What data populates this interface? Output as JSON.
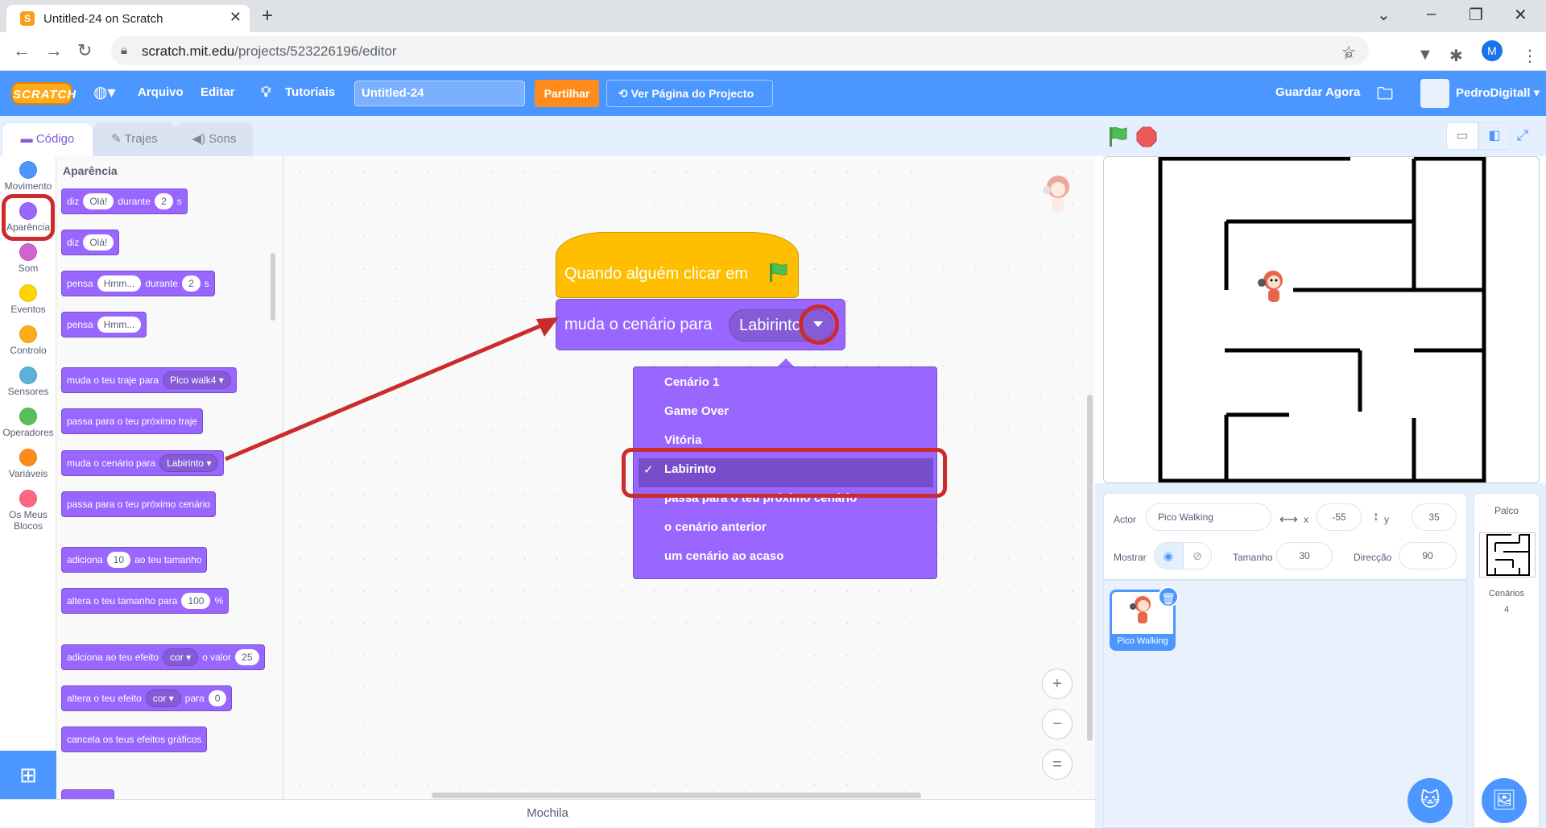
{
  "browser": {
    "tab_title": "Untitled-24 on Scratch",
    "tab_favicon": "S",
    "url_host": "scratch.mit.edu",
    "url_path": "/projects/523226196/editor",
    "profile_initial": "M"
  },
  "menubar": {
    "logo": "SCRATCH",
    "file": "Arquivo",
    "edit": "Editar",
    "tutorials": "Tutoriais",
    "project_title": "Untitled-24",
    "share": "Partilhar",
    "project_page": "Ver Página do Projecto",
    "save_now": "Guardar Agora",
    "username": "PedroDigitall"
  },
  "tabs": {
    "code": "Código",
    "costumes": "Trajes",
    "sounds": "Sons"
  },
  "categories": [
    {
      "label": "Movimento",
      "color": "#4c97ff"
    },
    {
      "label": "Aparência",
      "color": "#9966ff"
    },
    {
      "label": "Som",
      "color": "#cf63cf"
    },
    {
      "label": "Eventos",
      "color": "#ffd500"
    },
    {
      "label": "Controlo",
      "color": "#ffab19"
    },
    {
      "label": "Sensores",
      "color": "#5cb1d6"
    },
    {
      "label": "Operadores",
      "color": "#59c059"
    },
    {
      "label": "Variáveis",
      "color": "#ff8c1a"
    },
    {
      "label": "Os Meus Blocos",
      "color": "#ff6680"
    }
  ],
  "palette": {
    "heading": "Aparência",
    "say_for": {
      "t1": "diz",
      "v1": "Olá!",
      "t2": "durante",
      "v2": "2",
      "t3": "s"
    },
    "say": {
      "t1": "diz",
      "v1": "Olá!"
    },
    "think_for": {
      "t1": "pensa",
      "v1": "Hmm...",
      "t2": "durante",
      "v2": "2",
      "t3": "s"
    },
    "think": {
      "t1": "pensa",
      "v1": "Hmm..."
    },
    "switch_costume": {
      "t1": "muda o teu traje para",
      "v1": "Pico walk4"
    },
    "next_costume": "passa para o teu próximo traje",
    "switch_backdrop": {
      "t1": "muda o cenário para",
      "v1": "Labirinto"
    },
    "next_backdrop": "passa para o teu próximo cenário",
    "change_size": {
      "t1": "adiciona",
      "v1": "10",
      "t2": "ao teu tamanho"
    },
    "set_size": {
      "t1": "altera o teu tamanho para",
      "v1": "100",
      "t2": "%"
    },
    "change_effect": {
      "t1": "adiciona ao teu efeito",
      "v1": "cor",
      "t2": "o valor",
      "v2": "25"
    },
    "set_effect": {
      "t1": "altera o teu efeito",
      "v1": "cor",
      "t2": "para",
      "v2": "0"
    },
    "clear_effects": "cancela os teus efeitos gráficos"
  },
  "workspace": {
    "hat_label": "Quando alguém clicar em",
    "block_label": "muda o cenário para",
    "block_value": "Labirinto",
    "menu_items": [
      "Cenário 1",
      "Game Over",
      "Vitória",
      "Labirinto",
      "passa para o teu próximo cenário",
      "o cenário anterior",
      "um cenário ao acaso"
    ],
    "selected_check": "✓",
    "zoom_in": "+",
    "zoom_out": "−",
    "zoom_reset": "="
  },
  "backpack": "Mochila",
  "sprite_info": {
    "sprite_label": "Actor",
    "sprite_name": "Pico Walking",
    "x_label": "x",
    "x_value": "-55",
    "y_label": "y",
    "y_value": "35",
    "show_label": "Mostrar",
    "size_label": "Tamanho",
    "size_value": "30",
    "direction_label": "Direcção",
    "direction_value": "90"
  },
  "sprites": [
    {
      "name": "Pico Walking"
    }
  ],
  "stage_panel": {
    "title": "Palco",
    "backdrops_label": "Cenários",
    "backdrops_count": "4"
  },
  "colors": {
    "scratch_blue": "#4c97ff",
    "looks": "#9966ff",
    "events": "#ffbf00",
    "highlight": "#cc2b2b"
  }
}
